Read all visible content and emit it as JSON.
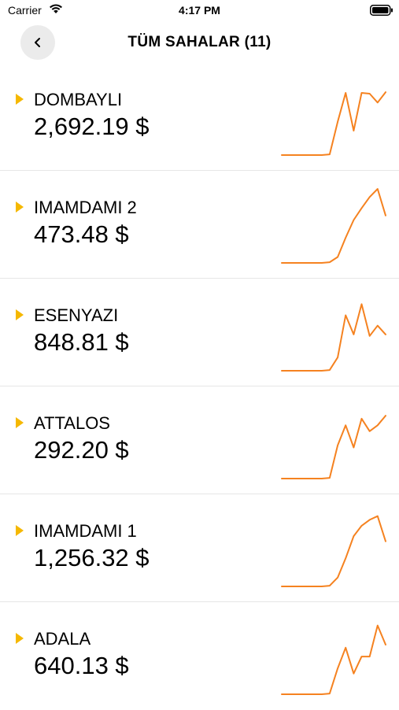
{
  "status_bar": {
    "carrier": "Carrier",
    "time": "4:17 PM"
  },
  "nav": {
    "title": "TÜM SAHALAR (11)",
    "back_icon": "chevron-left-icon"
  },
  "colors": {
    "accent_line": "#f58220",
    "marker": "#f5b800",
    "divider": "#e6e6e6"
  },
  "sites": [
    {
      "name": "DOMBAYLI",
      "amount": "2,692.19 $",
      "trend": [
        0,
        0,
        0,
        0,
        0,
        0,
        1,
        45,
        84,
        33,
        84,
        83,
        71,
        85
      ]
    },
    {
      "name": "IMAMDAMI 2",
      "amount": "473.48 $",
      "trend": [
        0,
        0,
        0,
        0,
        0,
        0,
        1,
        8,
        34,
        58,
        74,
        89,
        100,
        64
      ]
    },
    {
      "name": "ESENYAZI",
      "amount": "848.81 $",
      "trend": [
        0,
        0,
        0,
        0,
        0,
        0,
        1,
        18,
        75,
        49,
        90,
        47,
        61,
        49
      ]
    },
    {
      "name": "ATTALOS",
      "amount": "292.20 $",
      "trend": [
        0,
        0,
        0,
        0,
        0,
        0,
        1,
        45,
        72,
        42,
        81,
        64,
        72,
        85
      ]
    },
    {
      "name": "IMAMDAMI 1",
      "amount": "1,256.32 $",
      "trend": [
        0,
        0,
        0,
        0,
        0,
        0,
        1,
        12,
        38,
        68,
        82,
        90,
        95,
        61
      ]
    },
    {
      "name": "ADALA",
      "amount": "640.13 $",
      "trend": [
        0,
        0,
        0,
        0,
        0,
        0,
        1,
        35,
        63,
        28,
        51,
        51,
        93,
        67
      ]
    }
  ]
}
